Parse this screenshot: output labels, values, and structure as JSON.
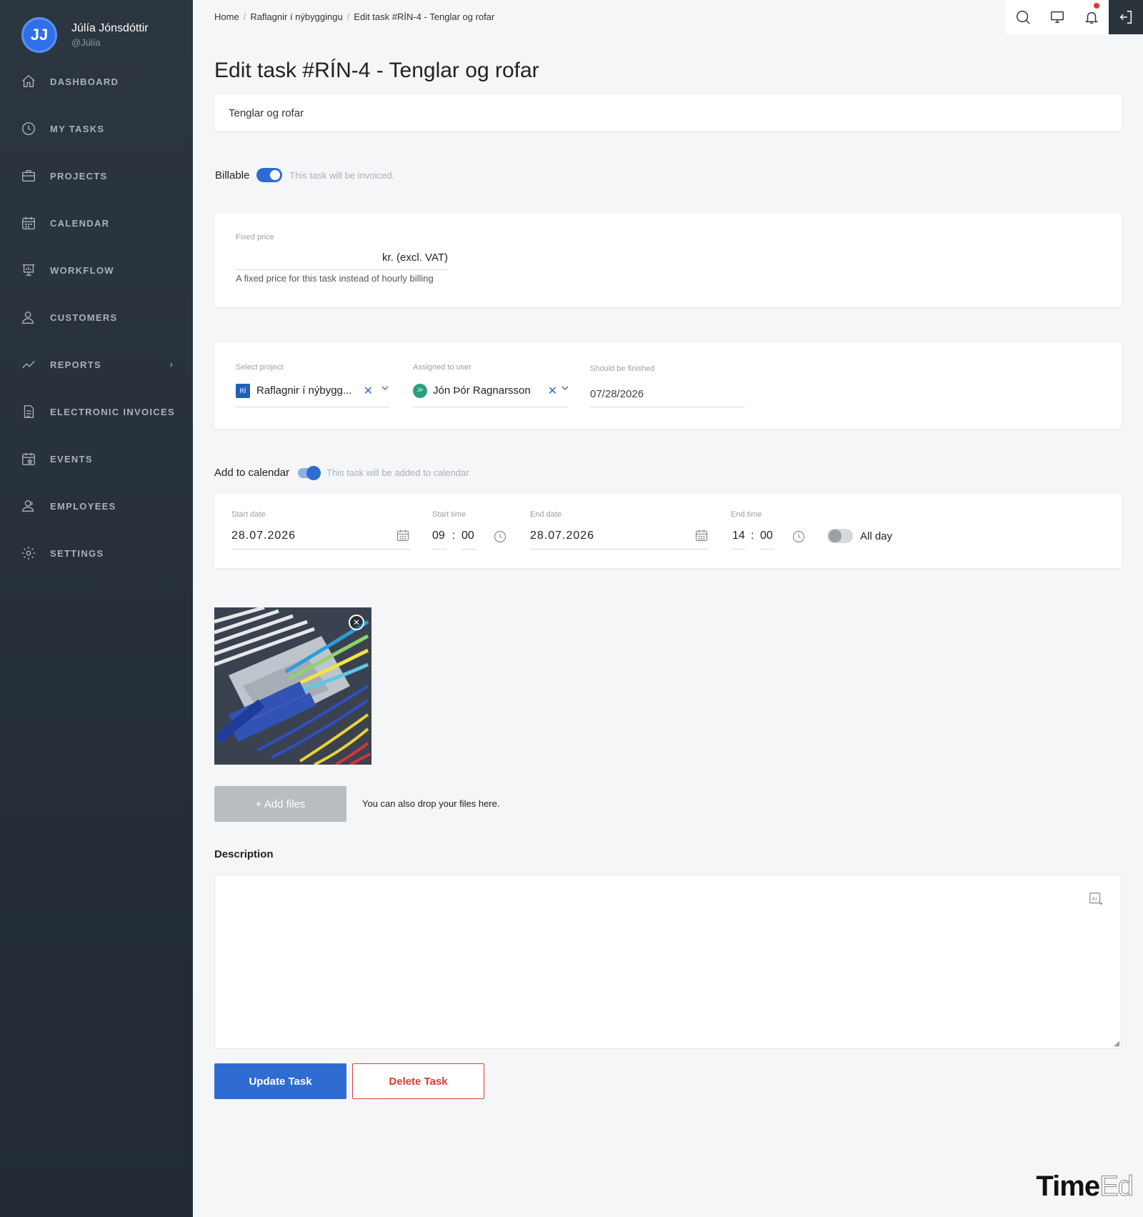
{
  "user": {
    "initials": "JJ",
    "name": "Júlía Jónsdóttir",
    "handle": "@Júlía"
  },
  "nav": [
    {
      "label": "DASHBOARD",
      "icon": "home-icon"
    },
    {
      "label": "MY TASKS",
      "icon": "clock-icon"
    },
    {
      "label": "PROJECTS",
      "icon": "briefcase-icon"
    },
    {
      "label": "CALENDAR",
      "icon": "calendar-icon"
    },
    {
      "label": "WORKFLOW",
      "icon": "presentation-icon"
    },
    {
      "label": "CUSTOMERS",
      "icon": "user-icon"
    },
    {
      "label": "REPORTS",
      "icon": "chart-line-icon"
    },
    {
      "label": "ELECTRONIC INVOICES",
      "icon": "document-icon"
    },
    {
      "label": "EVENTS",
      "icon": "calendar-star-icon"
    },
    {
      "label": "EMPLOYEES",
      "icon": "users-icon"
    },
    {
      "label": "SETTINGS",
      "icon": "gear-icon"
    }
  ],
  "breadcrumb": {
    "home": "Home",
    "project": "Raflagnir í nýbyggingu",
    "current": "Edit task #RÍN-4 - Tenglar og rofar",
    "sep": "/"
  },
  "page_title": "Edit task #RÍN-4 - Tenglar og rofar",
  "task_title": "Tenglar og rofar",
  "billable": {
    "label": "Billable",
    "hint": "This task will be invoiced.",
    "on": true
  },
  "fixed_price": {
    "label": "Fixed price",
    "unit": "kr. (excl. VAT)",
    "help": "A fixed price for this task instead of hourly billing"
  },
  "project": {
    "label": "Select project",
    "badge": "RÍ",
    "value": "Raflagnir í nýbygg..."
  },
  "assignee": {
    "label": "Assigned to user",
    "badge": "JÞ",
    "value": "Jón Þór Ragnarsson"
  },
  "due": {
    "label": "Should be finished",
    "value": "07/28/2026"
  },
  "calendar": {
    "label": "Add to calendar",
    "hint": "This task will be added to calendar",
    "on": true
  },
  "schedule": {
    "start_date_label": "Start date",
    "start_date": "28.07.2026",
    "start_time_label": "Start time",
    "start_hour": "09",
    "start_min": "00",
    "end_date_label": "End date",
    "end_date": "28.07.2026",
    "end_time_label": "End time",
    "end_hour": "14",
    "end_min": "00",
    "colon": ":",
    "all_day": "All day"
  },
  "files": {
    "add_label": "+ Add files",
    "drop_hint": "You can also drop your files here."
  },
  "description": {
    "label": "Description",
    "value": ""
  },
  "actions": {
    "update": "Update Task",
    "delete": "Delete Task"
  },
  "brand": {
    "part1": "Time",
    "part2": "Ed"
  },
  "colors": {
    "primary": "#2f6cd1",
    "danger": "#e03b32",
    "sidebar": "#2a333c"
  }
}
